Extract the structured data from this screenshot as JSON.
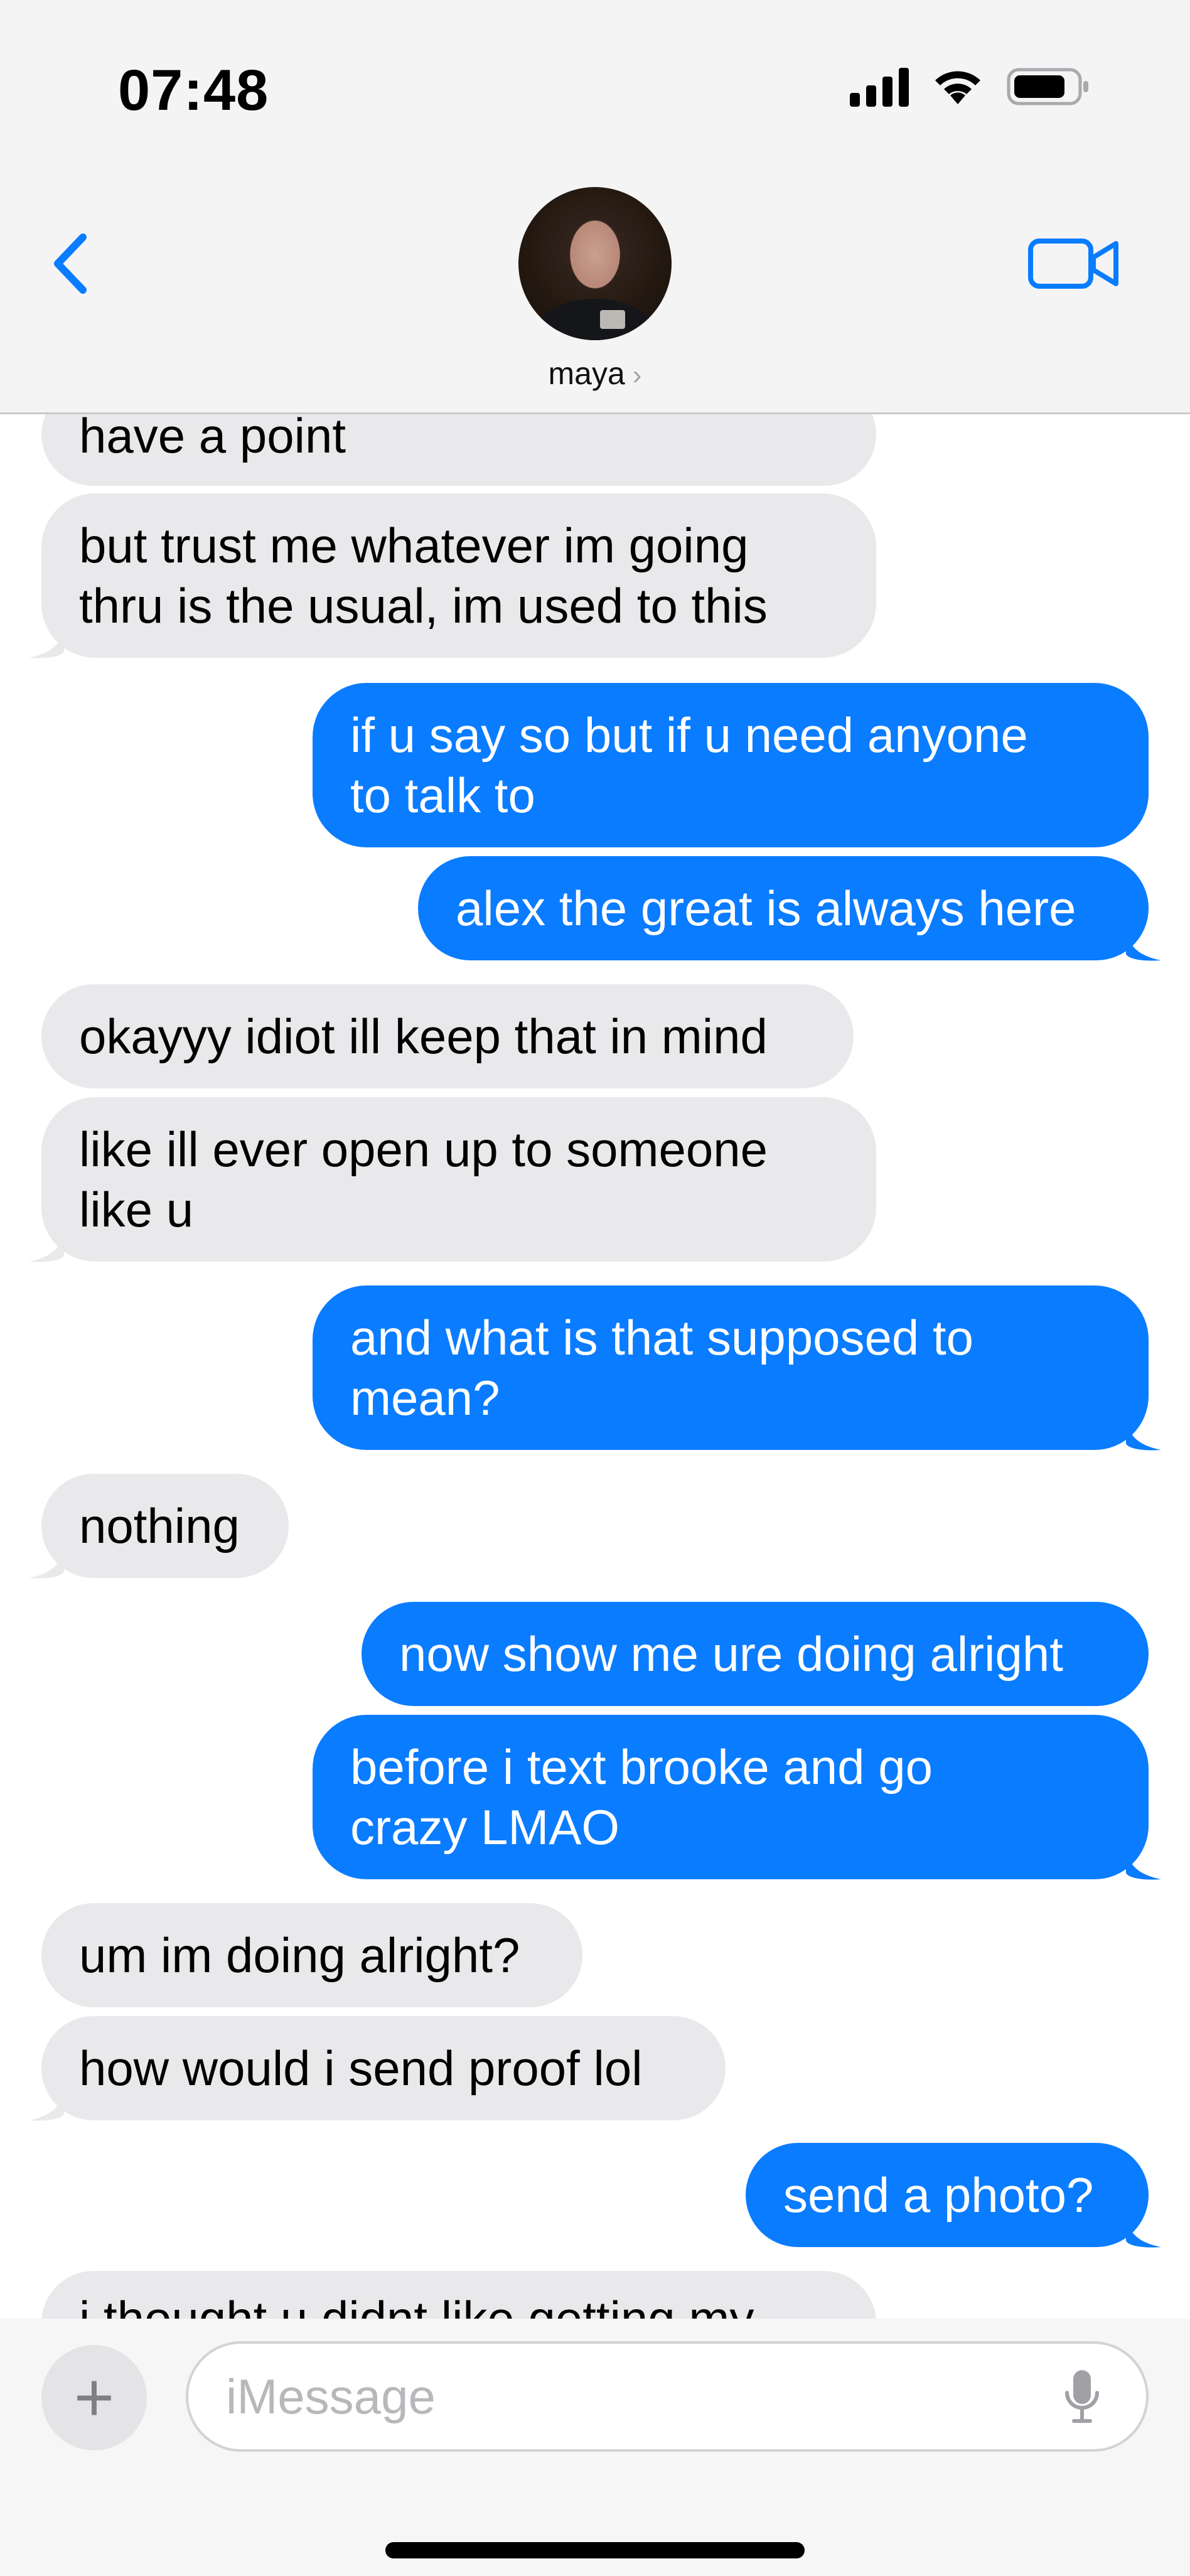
{
  "status_bar": {
    "time": "07:48"
  },
  "header": {
    "contact_name": "maya",
    "chevron": "›"
  },
  "messages": [
    {
      "text": "have a point",
      "direction": "incoming"
    },
    {
      "text": "but trust me whatever im going\nthru is the usual, im used to this",
      "direction": "incoming"
    },
    {
      "text": "if u say so but if u need anyone\nto talk to",
      "direction": "outgoing"
    },
    {
      "text": "alex the great is always here",
      "direction": "outgoing"
    },
    {
      "text": "okayyy idiot ill keep that in mind",
      "direction": "incoming"
    },
    {
      "text": "like ill ever open up to someone\nlike u",
      "direction": "incoming"
    },
    {
      "text": "and what is that supposed to\nmean?",
      "direction": "outgoing"
    },
    {
      "text": "nothing",
      "direction": "incoming"
    },
    {
      "text": "now show me ure doing alright",
      "direction": "outgoing"
    },
    {
      "text": "before i text brooke and go\ncrazy LMAO",
      "direction": "outgoing"
    },
    {
      "text": "um im doing alright?",
      "direction": "incoming"
    },
    {
      "text": "how would i send proof lol",
      "direction": "incoming"
    },
    {
      "text": "send a photo?",
      "direction": "outgoing"
    },
    {
      "text": "i thought u didnt like getting my",
      "direction": "incoming"
    }
  ],
  "compose": {
    "placeholder": "iMessage",
    "plus_label": "+"
  },
  "icons": {
    "back": "chevron-left-icon",
    "video": "video-camera-icon",
    "signal": "cellular-signal-icon",
    "wifi": "wifi-icon",
    "battery": "battery-icon",
    "mic": "microphone-icon"
  },
  "colors": {
    "outgoing_bubble": "#0a7cff",
    "incoming_bubble": "#e9e9eb",
    "accent": "#0a7cff",
    "header_bg": "#f4f4f5"
  }
}
